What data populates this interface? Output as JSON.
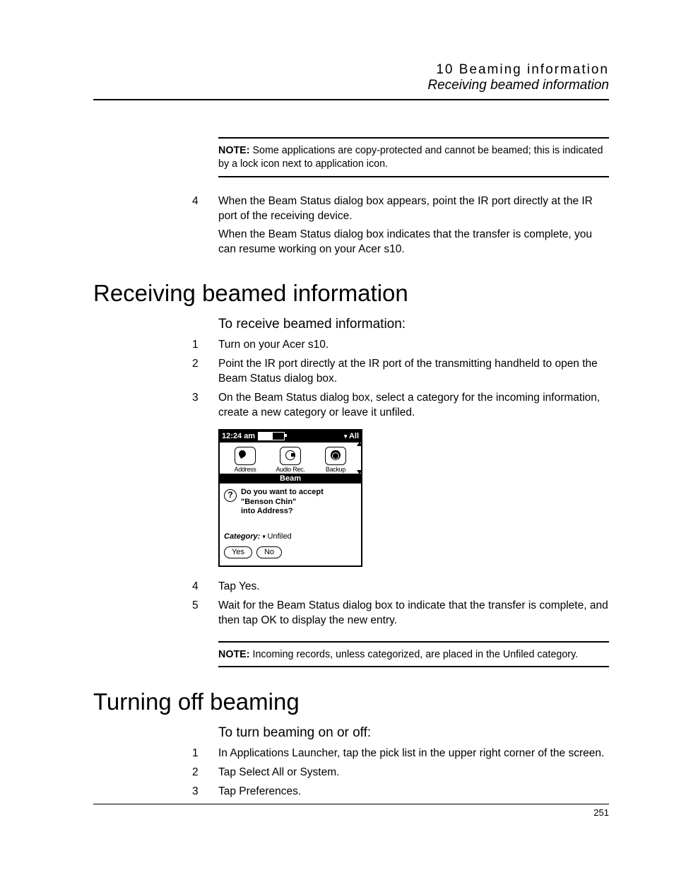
{
  "header": {
    "chapter": "10 Beaming information",
    "section": "Receiving beamed information"
  },
  "notes": {
    "label": "NOTE:",
    "note1_text": "Some applications are copy-protected and cannot be beamed; this is indicated by a lock icon next to application icon.",
    "note2_text": "Incoming records, unless categorized, are placed in the Unfiled category."
  },
  "top_list": {
    "item4_num": "4",
    "item4_p1": "When the Beam Status dialog box appears, point the IR port directly at the IR port of the receiving device.",
    "item4_p2": "When the Beam Status dialog box indicates that the transfer is complete, you can resume working on your Acer s10."
  },
  "section_receive": {
    "heading": "Receiving beamed information",
    "subheading": "To receive beamed information:",
    "items": {
      "i1_num": "1",
      "i1_text": "Turn on your Acer s10.",
      "i2_num": "2",
      "i2_text": "Point the IR port directly at the IR port of the transmitting handheld to open the Beam Status dialog box.",
      "i3_num": "3",
      "i3_text": "On the Beam Status dialog box, select a category for the incoming information, create a new category or leave it unfiled.",
      "i4_num": "4",
      "i4_text": "Tap Yes.",
      "i5_num": "5",
      "i5_text": "Wait for the Beam Status dialog box to indicate that the transfer is complete, and then tap OK to display the new entry."
    }
  },
  "palm": {
    "time": "12:24 am",
    "topright": "All",
    "icons": {
      "addr": "Address",
      "audio": "Audio Rec.",
      "backup": "Backup"
    },
    "beam_title": "Beam",
    "question_l1": "Do you want to accept",
    "question_l2": "\"Benson Chin\"",
    "question_l3": "into Address?",
    "category_label": "Category:",
    "category_value": "Unfiled",
    "yes": "Yes",
    "no": "No"
  },
  "section_off": {
    "heading": "Turning off beaming",
    "subheading": "To turn beaming on or off:",
    "items": {
      "i1_num": "1",
      "i1_text": "In Applications Launcher, tap the pick list in the upper right corner of the screen.",
      "i2_num": "2",
      "i2_text": "Tap Select All or System.",
      "i3_num": "3",
      "i3_text": "Tap Preferences."
    }
  },
  "page_number": "251"
}
